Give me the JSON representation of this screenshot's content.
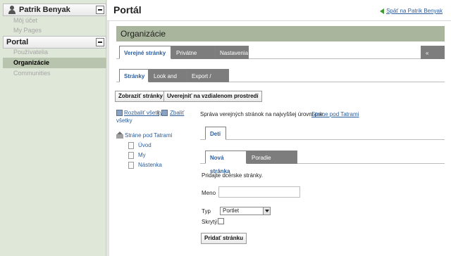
{
  "sidebar": {
    "user_name": "Patrik Benyak",
    "user_items": [
      "Môj účet",
      "My Pages"
    ],
    "portal_title": "Portal",
    "portal_items": [
      "Používatelia",
      "Organizácie",
      "Communities"
    ],
    "active_item": "Organizácie"
  },
  "header": {
    "title": "Portál",
    "back_link": "Späť na Patrik Benyak"
  },
  "main": {
    "section_title": "Organizácie",
    "tabs": [
      "Verejné stránky",
      "Privátne stránky",
      "Nastavenia"
    ],
    "back_button": "« Späť",
    "subtabs": [
      "Stránky",
      "Look and Feel",
      "Export / Import"
    ],
    "buttons": {
      "view_pages": "Zobraziť stránky",
      "publish_remote": "Uverejniť na vzdialenom prostredí"
    },
    "tree": {
      "expand_all": "Rozbaliť všetky",
      "separator": "|",
      "collapse_all_1": "Zbaliť",
      "collapse_all_2": "všetky",
      "root": "Stráne pod Tatrami",
      "children": [
        "Úvod",
        "My",
        "Nástenka"
      ]
    },
    "description": "Správa verejných stránok na najvyššej úrovni pre:",
    "description_link": "Stráne pod Tatrami",
    "children_tab": "Deti",
    "children_subtabs": [
      "Nová stránka",
      "Poradie zobrazenia"
    ],
    "form": {
      "intro": "Pridajte dcérske stránky.",
      "name_label": "Meno",
      "name_value": "",
      "type_label": "Typ",
      "type_value": "Portlet",
      "hidden_label": "Skrytý",
      "submit": "Pridať stránku"
    }
  },
  "colors": {
    "sidebar_bg": "#dfe7d8",
    "active_item_bg": "#b9c4ae",
    "section_bar": "#a9b59c",
    "link": "#2b5d9c",
    "inactive_tab": "#7d7d7d"
  }
}
